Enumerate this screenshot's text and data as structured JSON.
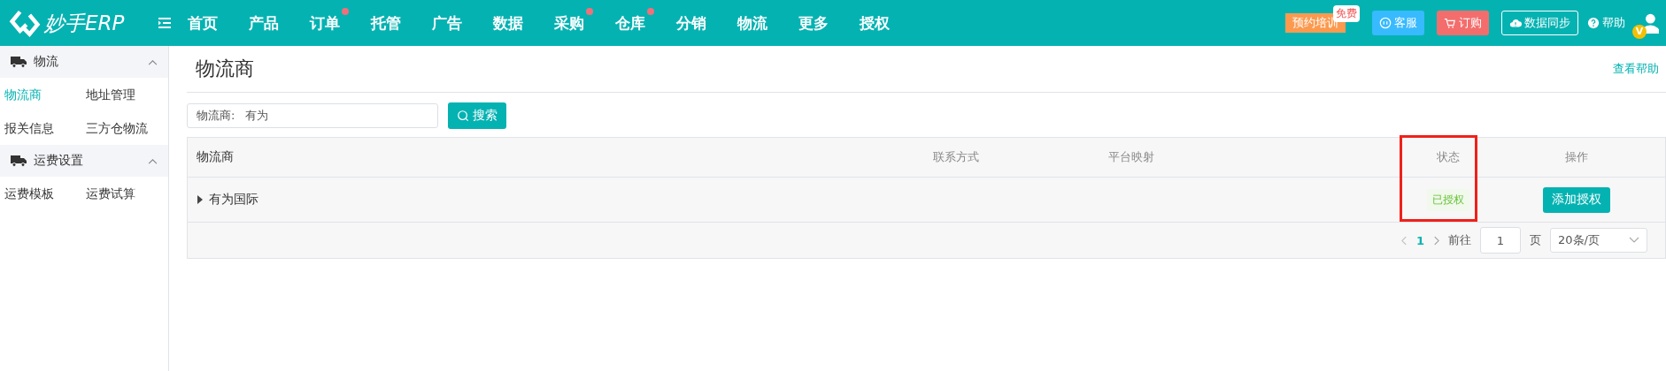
{
  "header": {
    "logo": "妙手ERP",
    "nav": [
      {
        "label": "首页",
        "dot": false
      },
      {
        "label": "产品",
        "dot": false
      },
      {
        "label": "订单",
        "dot": true
      },
      {
        "label": "托管",
        "dot": false
      },
      {
        "label": "广告",
        "dot": false
      },
      {
        "label": "数据",
        "dot": false
      },
      {
        "label": "采购",
        "dot": true
      },
      {
        "label": "仓库",
        "dot": true
      },
      {
        "label": "分销",
        "dot": false
      },
      {
        "label": "物流",
        "dot": false
      },
      {
        "label": "更多",
        "dot": false
      },
      {
        "label": "授权",
        "dot": false
      }
    ],
    "actions": [
      {
        "kind": "training",
        "label": "预约培训",
        "badge": "免费"
      },
      {
        "kind": "service",
        "label": "客服"
      },
      {
        "kind": "order",
        "label": "订购"
      },
      {
        "kind": "sync",
        "label": "数据同步"
      },
      {
        "kind": "help",
        "label": "帮助"
      }
    ],
    "avatar_badge": "V"
  },
  "sidebar": {
    "groups": [
      {
        "title": "物流",
        "expanded": true,
        "items": [
          {
            "label": "物流商",
            "selected": true
          },
          {
            "label": "地址管理",
            "selected": false
          },
          {
            "label": "报关信息",
            "selected": false
          },
          {
            "label": "三方仓物流",
            "selected": false
          }
        ]
      },
      {
        "title": "运费设置",
        "expanded": true,
        "items": [
          {
            "label": "运费模板",
            "selected": false
          },
          {
            "label": "运费试算",
            "selected": false
          }
        ]
      }
    ]
  },
  "page": {
    "title": "物流商",
    "help_link": "查看帮助"
  },
  "search": {
    "label": "物流商:",
    "value": "有为",
    "button": "搜索"
  },
  "table": {
    "columns": [
      {
        "label": "物流商",
        "highlighted": false
      },
      {
        "label": "联系方式",
        "highlighted": false
      },
      {
        "label": "平台映射",
        "highlighted": false
      },
      {
        "label": "状态",
        "highlighted": true
      },
      {
        "label": "操作",
        "highlighted": false
      }
    ],
    "rows": [
      {
        "name": "有为国际",
        "expanded": false,
        "status": "已授权",
        "action": "添加授权"
      }
    ]
  },
  "pagination": {
    "current_page": "1",
    "goto_label": "前往",
    "goto_value": "1",
    "page_unit": "页",
    "page_size": "20条/页"
  }
}
